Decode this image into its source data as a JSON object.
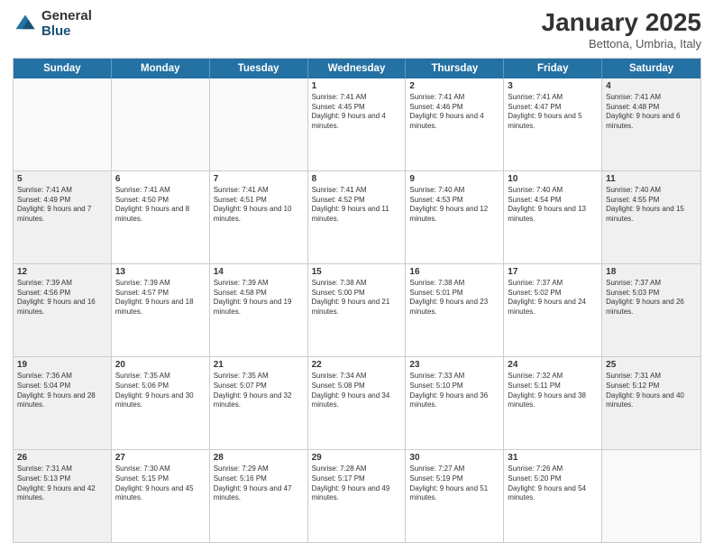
{
  "header": {
    "logo_general": "General",
    "logo_blue": "Blue",
    "month_title": "January 2025",
    "subtitle": "Bettona, Umbria, Italy"
  },
  "days_of_week": [
    "Sunday",
    "Monday",
    "Tuesday",
    "Wednesday",
    "Thursday",
    "Friday",
    "Saturday"
  ],
  "weeks": [
    [
      {
        "num": "",
        "text": "",
        "empty": true
      },
      {
        "num": "",
        "text": "",
        "empty": true
      },
      {
        "num": "",
        "text": "",
        "empty": true
      },
      {
        "num": "1",
        "text": "Sunrise: 7:41 AM\nSunset: 4:45 PM\nDaylight: 9 hours and 4 minutes."
      },
      {
        "num": "2",
        "text": "Sunrise: 7:41 AM\nSunset: 4:46 PM\nDaylight: 9 hours and 4 minutes."
      },
      {
        "num": "3",
        "text": "Sunrise: 7:41 AM\nSunset: 4:47 PM\nDaylight: 9 hours and 5 minutes."
      },
      {
        "num": "4",
        "text": "Sunrise: 7:41 AM\nSunset: 4:48 PM\nDaylight: 9 hours and 6 minutes."
      }
    ],
    [
      {
        "num": "5",
        "text": "Sunrise: 7:41 AM\nSunset: 4:49 PM\nDaylight: 9 hours and 7 minutes."
      },
      {
        "num": "6",
        "text": "Sunrise: 7:41 AM\nSunset: 4:50 PM\nDaylight: 9 hours and 8 minutes."
      },
      {
        "num": "7",
        "text": "Sunrise: 7:41 AM\nSunset: 4:51 PM\nDaylight: 9 hours and 10 minutes."
      },
      {
        "num": "8",
        "text": "Sunrise: 7:41 AM\nSunset: 4:52 PM\nDaylight: 9 hours and 11 minutes."
      },
      {
        "num": "9",
        "text": "Sunrise: 7:40 AM\nSunset: 4:53 PM\nDaylight: 9 hours and 12 minutes."
      },
      {
        "num": "10",
        "text": "Sunrise: 7:40 AM\nSunset: 4:54 PM\nDaylight: 9 hours and 13 minutes."
      },
      {
        "num": "11",
        "text": "Sunrise: 7:40 AM\nSunset: 4:55 PM\nDaylight: 9 hours and 15 minutes."
      }
    ],
    [
      {
        "num": "12",
        "text": "Sunrise: 7:39 AM\nSunset: 4:56 PM\nDaylight: 9 hours and 16 minutes."
      },
      {
        "num": "13",
        "text": "Sunrise: 7:39 AM\nSunset: 4:57 PM\nDaylight: 9 hours and 18 minutes."
      },
      {
        "num": "14",
        "text": "Sunrise: 7:39 AM\nSunset: 4:58 PM\nDaylight: 9 hours and 19 minutes."
      },
      {
        "num": "15",
        "text": "Sunrise: 7:38 AM\nSunset: 5:00 PM\nDaylight: 9 hours and 21 minutes."
      },
      {
        "num": "16",
        "text": "Sunrise: 7:38 AM\nSunset: 5:01 PM\nDaylight: 9 hours and 23 minutes."
      },
      {
        "num": "17",
        "text": "Sunrise: 7:37 AM\nSunset: 5:02 PM\nDaylight: 9 hours and 24 minutes."
      },
      {
        "num": "18",
        "text": "Sunrise: 7:37 AM\nSunset: 5:03 PM\nDaylight: 9 hours and 26 minutes."
      }
    ],
    [
      {
        "num": "19",
        "text": "Sunrise: 7:36 AM\nSunset: 5:04 PM\nDaylight: 9 hours and 28 minutes."
      },
      {
        "num": "20",
        "text": "Sunrise: 7:35 AM\nSunset: 5:06 PM\nDaylight: 9 hours and 30 minutes."
      },
      {
        "num": "21",
        "text": "Sunrise: 7:35 AM\nSunset: 5:07 PM\nDaylight: 9 hours and 32 minutes."
      },
      {
        "num": "22",
        "text": "Sunrise: 7:34 AM\nSunset: 5:08 PM\nDaylight: 9 hours and 34 minutes."
      },
      {
        "num": "23",
        "text": "Sunrise: 7:33 AM\nSunset: 5:10 PM\nDaylight: 9 hours and 36 minutes."
      },
      {
        "num": "24",
        "text": "Sunrise: 7:32 AM\nSunset: 5:11 PM\nDaylight: 9 hours and 38 minutes."
      },
      {
        "num": "25",
        "text": "Sunrise: 7:31 AM\nSunset: 5:12 PM\nDaylight: 9 hours and 40 minutes."
      }
    ],
    [
      {
        "num": "26",
        "text": "Sunrise: 7:31 AM\nSunset: 5:13 PM\nDaylight: 9 hours and 42 minutes."
      },
      {
        "num": "27",
        "text": "Sunrise: 7:30 AM\nSunset: 5:15 PM\nDaylight: 9 hours and 45 minutes."
      },
      {
        "num": "28",
        "text": "Sunrise: 7:29 AM\nSunset: 5:16 PM\nDaylight: 9 hours and 47 minutes."
      },
      {
        "num": "29",
        "text": "Sunrise: 7:28 AM\nSunset: 5:17 PM\nDaylight: 9 hours and 49 minutes."
      },
      {
        "num": "30",
        "text": "Sunrise: 7:27 AM\nSunset: 5:19 PM\nDaylight: 9 hours and 51 minutes."
      },
      {
        "num": "31",
        "text": "Sunrise: 7:26 AM\nSunset: 5:20 PM\nDaylight: 9 hours and 54 minutes."
      },
      {
        "num": "",
        "text": "",
        "empty": true
      }
    ]
  ]
}
